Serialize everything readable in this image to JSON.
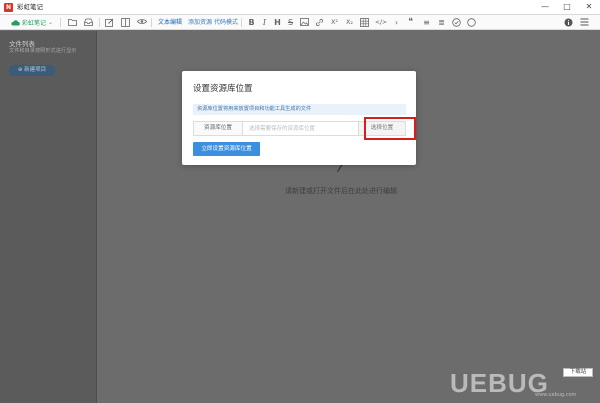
{
  "window": {
    "title": "彩虹笔记",
    "app_icon_glyph": "N",
    "controls": [
      "—",
      "□",
      "✕"
    ]
  },
  "toolbar": {
    "notebook_name": "彩虹笔记",
    "notebook_chevron": "⌄",
    "modes": [
      "文本编辑",
      "添加资源",
      "代码模式"
    ],
    "format_buttons": [
      "B",
      "I",
      "H",
      "S",
      "X²",
      "X₂",
      "</>",
      "❝",
      "≡",
      "≣"
    ],
    "icons": [
      "folder-icon",
      "inbox-icon",
      "edit-icon",
      "columns-icon",
      "eye-icon",
      "image-icon",
      "link-icon",
      "table-icon",
      "chevron-icon",
      "checkbox-icon",
      "circle-icon",
      "info-icon",
      "menu-icon"
    ]
  },
  "sidebar": {
    "title": "文件列表",
    "subtitle": "文件和目录按照形式进行显示",
    "new_project_label": "⊕ 新建项目"
  },
  "main": {
    "empty_hint": "请新建或打开文件后在此处进行编辑"
  },
  "dialog": {
    "title": "设置资源库位置",
    "info": "资源库位置将用来放置项目和功能工具生成的文件",
    "field_label": "资源库位置",
    "field_placeholder": "选择需要保存的资源库位置",
    "field_value": "",
    "choose_button": "选择位置",
    "confirm_button": "立即设置资源库位置"
  },
  "watermark": {
    "logo": "UEBUG",
    "badge": "下载站",
    "url": "www.uebug.com"
  },
  "colors": {
    "accent": "#3c8fdf",
    "notebook_green": "#2b9a63",
    "highlight_red": "#d51f1f",
    "overlay": "#6c6c6c"
  }
}
